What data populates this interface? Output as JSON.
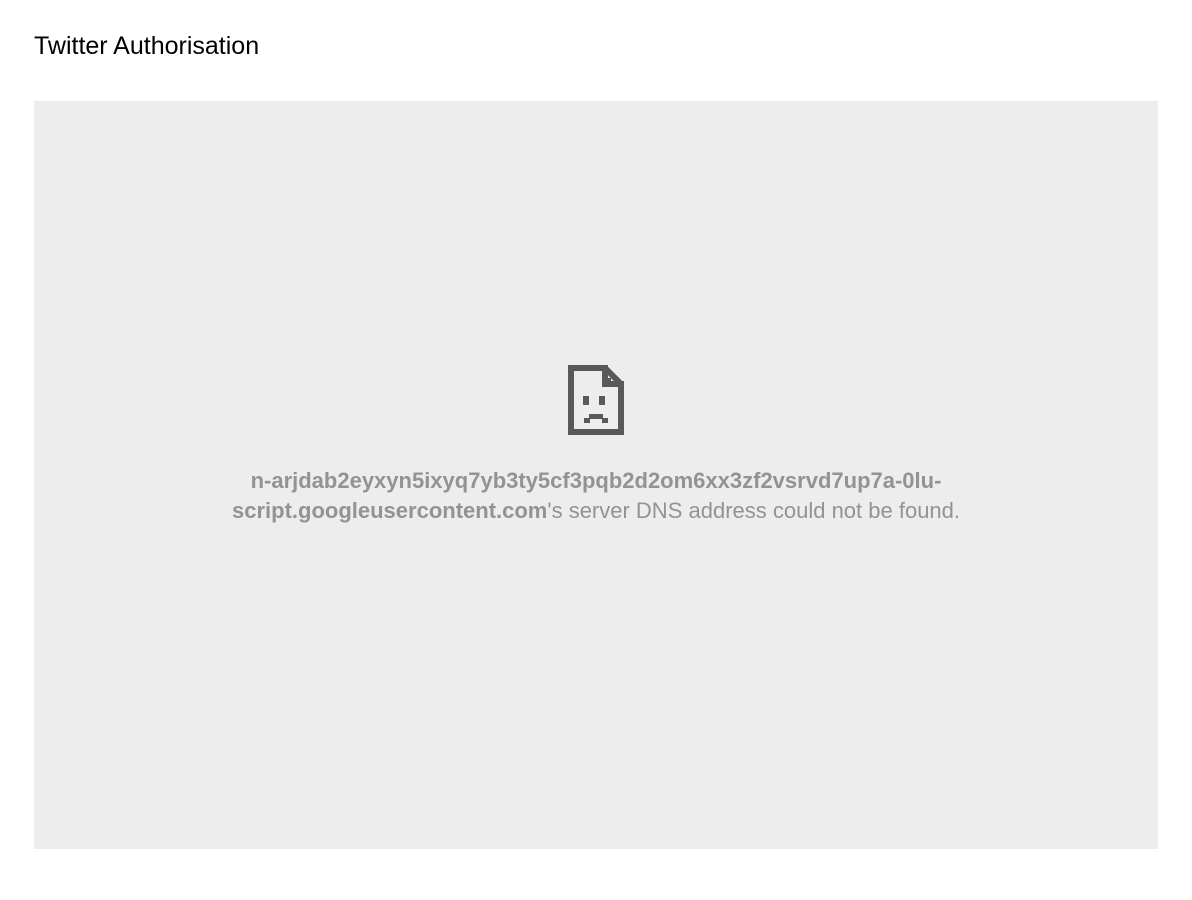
{
  "page": {
    "title": "Twitter Authorisation"
  },
  "error": {
    "host": "n-arjdab2eyxyn5ixyq7yb3ty5cf3pqb2d2om6xx3zf2vsrvd7up7a-0lu-script.googleusercontent.com",
    "suffix": "'s server DNS address could not be found."
  }
}
